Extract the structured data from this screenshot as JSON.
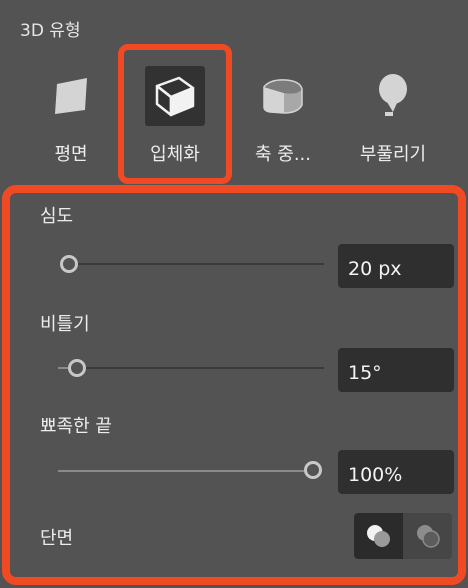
{
  "section": {
    "title": "3D 유형"
  },
  "types": [
    {
      "label": "평면",
      "icon": "plane-icon"
    },
    {
      "label": "입체화",
      "icon": "extrude-cube-icon",
      "selected": true
    },
    {
      "label": "축 중...",
      "icon": "revolve-icon"
    },
    {
      "label": "부풀리기",
      "icon": "inflate-icon"
    }
  ],
  "options": {
    "depth": {
      "label": "심도",
      "value": "20 px",
      "level": 0.0
    },
    "twist": {
      "label": "비틀기",
      "value": "15°",
      "level": 0.08
    },
    "taper": {
      "label": "뾰족한 끝",
      "value": "100%",
      "level": 1.0
    },
    "cap": {
      "label": "단면"
    }
  },
  "colors": {
    "highlight": "#f04a25",
    "panel": "#535353",
    "field": "#2f2f2f"
  }
}
